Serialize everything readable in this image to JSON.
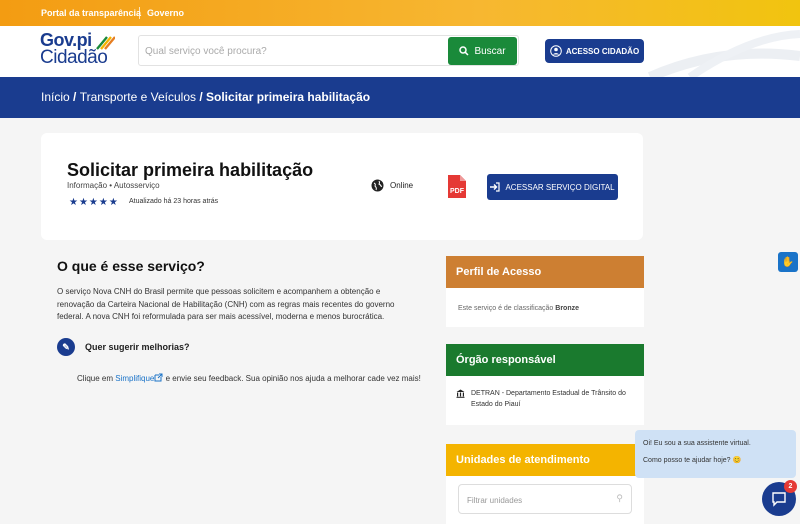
{
  "topbar": {
    "link1": "Portal da transparência",
    "link2": "Governo"
  },
  "logo": {
    "line1_prefix": "Gov.",
    "line1_pi": "pi",
    "line2": "Cidadão"
  },
  "search": {
    "placeholder": "Qual serviço você procura?",
    "button_label": "Buscar"
  },
  "header": {
    "access_label": "ACESSO CIDADÃO"
  },
  "breadcrumb": {
    "home": "Início",
    "sep": " / ",
    "category": "Transporte e Veículos",
    "current": "Solicitar primeira habilitação"
  },
  "service": {
    "title": "Solicitar primeira habilitação",
    "meta": "Informação  •  Autosserviço",
    "rating_stars": "★★★★★",
    "updated": "Atualizado há 23 horas atrás",
    "online_label": "Online",
    "pdf_label": "PDF",
    "digital_button": "ACESSAR SERVIÇO DIGITAL"
  },
  "about": {
    "heading": "O que é esse serviço?",
    "description": "O serviço Nova CNH do Brasil permite que pessoas solicitem e acompanhem a obtenção e renovação da Carteira Nacional de Habilitação (CNH) com as regras mais recentes do governo federal. A nova CNH foi reformulada para ser mais acessível, moderna e menos burocrática.",
    "suggest_label": "Quer sugerir melhorias?",
    "feedback_pre": "Clique em ",
    "feedback_link": "Simplifique",
    "feedback_post": " e envie seu feedback. Sua opinião nos ajuda a melhorar cade vez mais!"
  },
  "panels": {
    "profile": {
      "title": "Perfil de Acesso",
      "text_pre": "Este serviço é de classificação ",
      "level": "Bronze"
    },
    "organ": {
      "title": "Órgão responsável",
      "name": "DETRAN - Departamento Estadual de Trânsito do Estado do Piauí"
    },
    "units": {
      "title": "Unidades de atendimento",
      "filter_placeholder": "Filtrar unidades"
    }
  },
  "chat": {
    "line1": "Oi! Eu sou a sua assistente virtual.",
    "line2": "Como posso te ajudar hoje? 😊",
    "badge": "2"
  },
  "colors": {
    "primary": "#1a3c8f",
    "green": "#1a8a3a",
    "orange": "#f39c12",
    "bronze": "#cd7f32",
    "gold": "#f4b400"
  }
}
